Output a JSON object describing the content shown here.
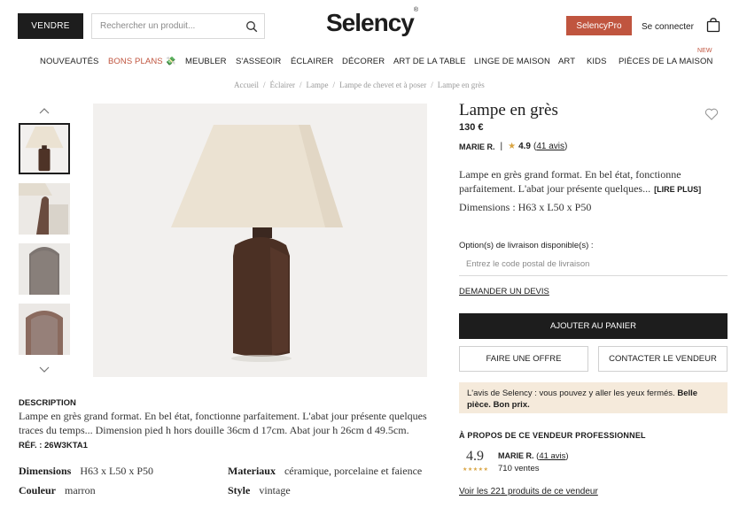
{
  "header": {
    "sell_label": "VENDRE",
    "search_placeholder": "Rechercher un produit...",
    "logo": "Selency",
    "logo_mark": "®",
    "pro_label": "SelencyPro",
    "login_label": "Se connecter"
  },
  "nav": {
    "items": [
      "NOUVEAUTÉS",
      "BONS PLANS 💸",
      "MEUBLER",
      "S'ASSEOIR",
      "ÉCLAIRER",
      "DÉCORER",
      "ART DE LA TABLE",
      "LINGE DE MAISON",
      "ART",
      "KIDS",
      "PIÈCES DE LA MAISON"
    ],
    "new_badge": "NEW"
  },
  "breadcrumb": [
    "Accueil",
    "Éclairer",
    "Lampe",
    "Lampe de chevet et à poser",
    "Lampe en grès"
  ],
  "breadcrumb_sep": "/",
  "product": {
    "title": "Lampe en grès",
    "price": "130 €",
    "seller": "MARIE R.",
    "separator": "|",
    "rating": "4.9",
    "reviews_open": "(",
    "reviews": "41 avis",
    "reviews_close": ")",
    "short_description": "Lampe en grès grand format. En bel état, fonctionne parfaitement. L'abat jour présente quelques...",
    "read_more": "[LIRE PLUS]",
    "dimensions_short": "Dimensions : H63 x L50 x P50",
    "delivery_label": "Option(s) de livraison disponible(s) :",
    "postal_placeholder": "Entrez le code postal de livraison",
    "quote_link": "DEMANDER UN DEVIS",
    "add_to_cart": "AJOUTER AU PANIER",
    "make_offer": "FAIRE UNE OFFRE",
    "contact_seller": "CONTACTER LE VENDEUR",
    "selency_opinion": "L'avis de Selency : vous pouvez y aller les yeux fermés. ",
    "selency_opinion_bold": "Belle pièce. Bon prix."
  },
  "seller_pro": {
    "heading": "À PROPOS DE CE VENDEUR PROFESSIONNEL",
    "rating": "4.9",
    "stars": "★★★★★",
    "name": "MARIE R.",
    "reviews": "41 avis",
    "sales": "710 ventes",
    "products_link": "Voir les 221 produits de ce vendeur"
  },
  "details": {
    "heading": "DESCRIPTION",
    "text": "Lampe en grès grand format. En bel état, fonctionne parfaitement. L'abat jour présente quelques traces du temps... Dimension pied h hors douille 36cm d 17cm. Abat jour h 26cm d 49.5cm.",
    "ref": "RÉF. : 26W3KTA1",
    "specs": [
      {
        "key": "Dimensions",
        "value": "H63 x L50 x P50"
      },
      {
        "key": "Materiaux",
        "value": "céramique, porcelaine et faience"
      },
      {
        "key": "Couleur",
        "value": "marron"
      },
      {
        "key": "Style",
        "value": "vintage"
      }
    ]
  },
  "colors": {
    "accent": "#c0553f",
    "dark": "#1d1d1d",
    "opinion_bg": "#f5eadb",
    "star": "#d9a441"
  },
  "icons": [
    "search-icon",
    "bag-icon",
    "heart-icon",
    "chevron-up-icon",
    "chevron-down-icon",
    "star-icon"
  ]
}
